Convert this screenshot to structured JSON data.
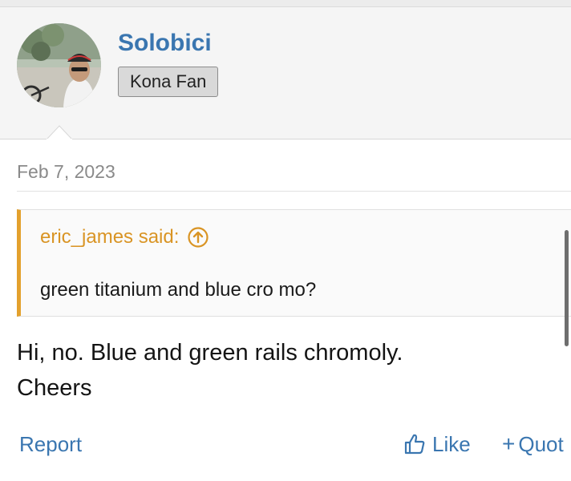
{
  "user": {
    "name": "Solobici",
    "badge": "Kona Fan"
  },
  "post": {
    "date": "Feb 7, 2023",
    "quote": {
      "author_label": "eric_james said:",
      "text": "green titanium and blue cro mo?",
      "icon": "arrow-up-circle-icon"
    },
    "message_lines": [
      "Hi, no. Blue and green rails chromoly.",
      "Cheers"
    ]
  },
  "actions": {
    "report": "Report",
    "like": "Like",
    "like_icon": "thumbs-up-icon",
    "quote": "Quot",
    "quote_icon": "plus-icon"
  },
  "colors": {
    "link": "#3a76b0",
    "quote_accent": "#e3a12d",
    "quote_author": "#d99424",
    "user_block_bg": "#f5f5f5"
  }
}
